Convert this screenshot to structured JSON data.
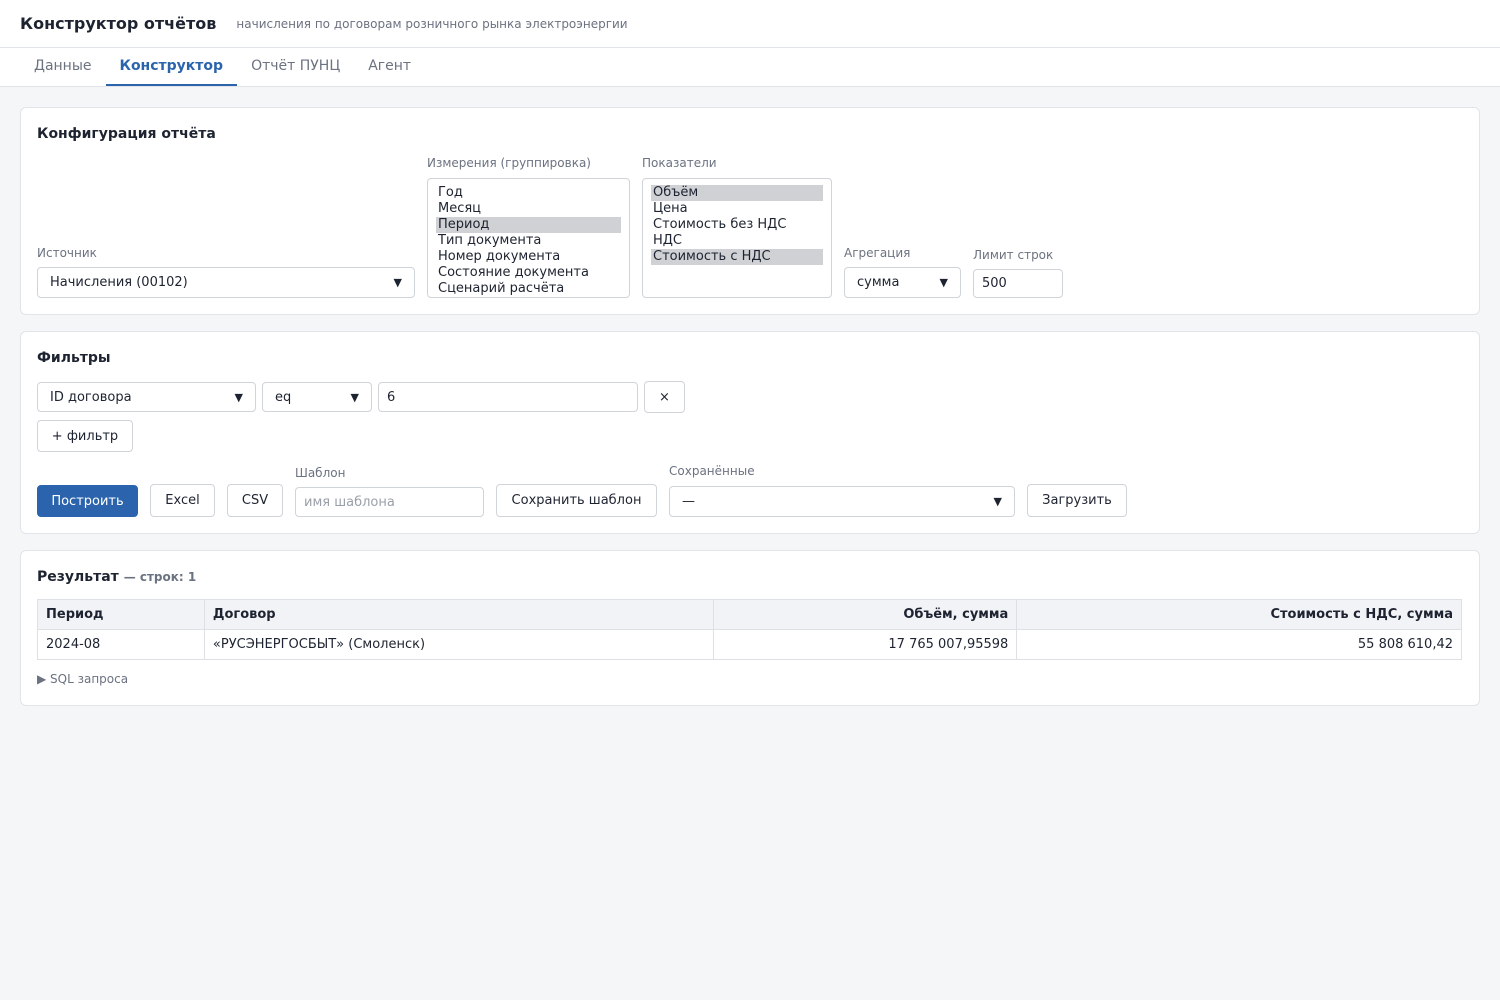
{
  "app": {
    "title": "Конструктор отчётов",
    "subtitle": "начисления по договорам розничного рынка электроэнергии"
  },
  "tabs": [
    {
      "label": "Данные",
      "active": false
    },
    {
      "label": "Конструктор",
      "active": true
    },
    {
      "label": "Отчёт ПУНЦ",
      "active": false
    },
    {
      "label": "Агент",
      "active": false
    }
  ],
  "config": {
    "title": "Конфигурация отчёта",
    "source": {
      "label": "Источник",
      "value": "Начисления (00102)"
    },
    "dimensions": {
      "label": "Измерения (группировка)",
      "options": [
        {
          "text": "Год",
          "selected": false
        },
        {
          "text": "Месяц",
          "selected": false
        },
        {
          "text": "Период",
          "selected": true
        },
        {
          "text": "Тип документа",
          "selected": false
        },
        {
          "text": "Номер документа",
          "selected": false
        },
        {
          "text": "Состояние документа",
          "selected": false
        },
        {
          "text": "Сценарий расчёта",
          "selected": false
        }
      ]
    },
    "measures": {
      "label": "Показатели",
      "options": [
        {
          "text": "Объём",
          "selected": true
        },
        {
          "text": "Цена",
          "selected": false
        },
        {
          "text": "Стоимость без НДС",
          "selected": false
        },
        {
          "text": "НДС",
          "selected": false
        },
        {
          "text": "Стоимость с НДС",
          "selected": true
        }
      ]
    },
    "aggregation": {
      "label": "Агрегация",
      "value": "сумма"
    },
    "limit": {
      "label": "Лимит строк",
      "value": "500"
    }
  },
  "filters": {
    "title": "Фильтры",
    "rows": [
      {
        "field": "ID договора",
        "op": "eq",
        "value": "6",
        "remove": "×"
      }
    ],
    "add_label": "+ фильтр",
    "build_label": "Построить",
    "excel_label": "Excel",
    "csv_label": "CSV",
    "template": {
      "label": "Шаблон",
      "placeholder": "имя шаблона",
      "save_label": "Сохранить шаблон"
    },
    "saved": {
      "label": "Сохранённые",
      "value": "—",
      "load_label": "Загрузить"
    }
  },
  "result": {
    "title": "Результат",
    "count_text": "— строк: 1",
    "columns": [
      "Период",
      "Договор",
      "Объём, сумма",
      "Стоимость с НДС, сумма"
    ],
    "rows": [
      [
        "2024-08",
        "«РУСЭНЕРГОСБЫТ» (Смоленск)",
        "17 765 007,95598",
        "55 808 610,42"
      ]
    ],
    "sql_toggle": "▶ SQL запроса"
  }
}
